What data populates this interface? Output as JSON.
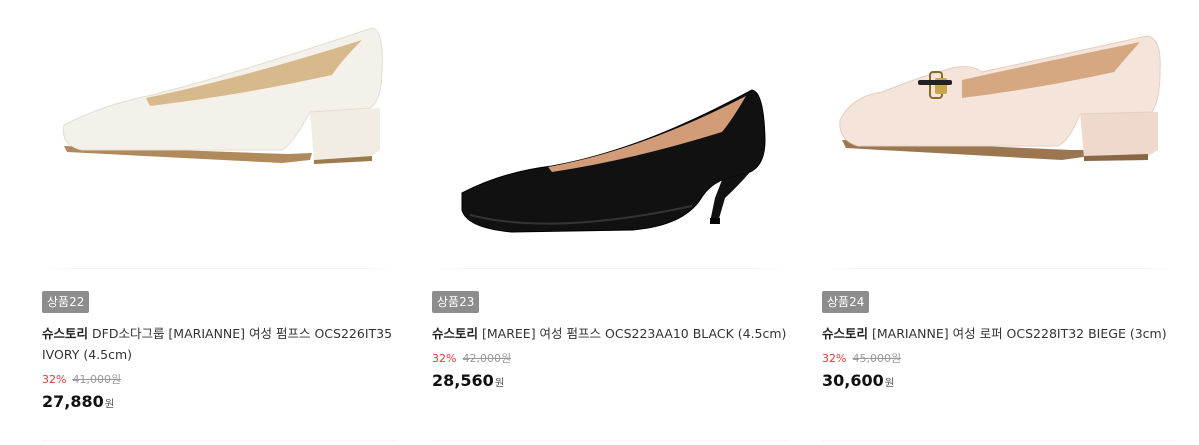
{
  "products": [
    {
      "badge": "상품22",
      "brand": "슈스토리",
      "title": "DFD소다그룹 [MARIANNE] 여성 펌프스 OCS226IT35 IVORY (4.5cm)",
      "discount": "32%",
      "original_price": "41,000원",
      "price": "27,880",
      "currency": "원",
      "image": "ivory-pump-shoe"
    },
    {
      "badge": "상품23",
      "brand": "슈스토리",
      "title": "[MAREE] 여성 펌프스 OCS223AA10 BLACK (4.5cm)",
      "discount": "32%",
      "original_price": "42,000원",
      "price": "28,560",
      "currency": "원",
      "image": "black-pump-shoe"
    },
    {
      "badge": "상품24",
      "brand": "슈스토리",
      "title": "[MARIANNE] 여성 로퍼 OCS228IT32 BIEGE (3cm)",
      "discount": "32%",
      "original_price": "45,000원",
      "price": "30,600",
      "currency": "원",
      "image": "beige-loafer-shoe"
    }
  ],
  "colors": {
    "badge_bg": "#8d8d8d",
    "discount": "#e53935",
    "original_price": "#999999"
  }
}
